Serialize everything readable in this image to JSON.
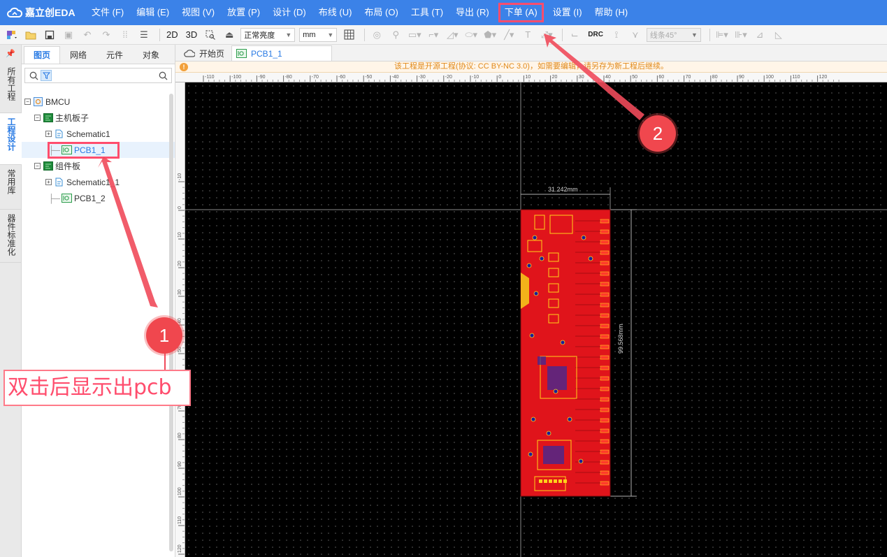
{
  "app": {
    "logo_text": "嘉立创EDA"
  },
  "menu": {
    "items": [
      "文件 (F)",
      "编辑 (E)",
      "视图 (V)",
      "放置 (P)",
      "设计 (D)",
      "布线 (U)",
      "布局 (O)",
      "工具 (T)",
      "导出 (R)",
      "下单 (A)",
      "设置 (I)",
      "帮助 (H)"
    ],
    "highlighted": "下单 (A)"
  },
  "toolbar": {
    "btn_2d": "2D",
    "btn_3d": "3D",
    "brightness": "正常亮度",
    "unit": "mm",
    "drc": "DRC",
    "line_mode": "线条45°"
  },
  "side_tabs": [
    "所有工程",
    "工程设计",
    "常用库",
    "器件标准化"
  ],
  "side_tabs_active": "工程设计",
  "panel": {
    "tabs": [
      "图页",
      "网络",
      "元件",
      "对象"
    ],
    "active_tab": "图页",
    "search_placeholder": ""
  },
  "tree": {
    "project": "BMCU",
    "boards": [
      {
        "name": "主机板子",
        "schematic": "Schematic1",
        "pcb": "PCB1_1"
      },
      {
        "name": "组件板",
        "schematic": "Schematic1_1",
        "pcb": "PCB1_2"
      }
    ],
    "selected": "PCB1_1"
  },
  "doc_tabs": [
    "开始页",
    "PCB1_1"
  ],
  "doc_tab_active": "PCB1_1",
  "notice": "该工程是开源工程(协议: CC BY-NC 3.0)，如需要编辑，请另存为新工程后继续。",
  "ruler": {
    "h_labels": [
      "-110",
      "-100",
      "-90",
      "-80",
      "-70",
      "-60",
      "-50",
      "-40",
      "-30",
      "-20",
      "-10",
      "0",
      "10",
      "20",
      "30",
      "40",
      "50",
      "60",
      "70",
      "80",
      "90",
      "100",
      "110",
      "120"
    ],
    "v_labels": [
      "-10",
      "0",
      "10",
      "20",
      "30",
      "40",
      "50",
      "60",
      "70",
      "80",
      "90",
      "100",
      "110",
      "120"
    ]
  },
  "pcb": {
    "width_label": "31.242mm",
    "height_label": "99.568mm",
    "colors": {
      "board": "#e0141b",
      "silk": "#ffd21a",
      "via": "#1b1f9a",
      "canvas": "#000000"
    }
  },
  "annotations": {
    "badge1": "1",
    "badge2": "2",
    "caption": "双击后显示出pcb",
    "color": "#f0474e"
  }
}
